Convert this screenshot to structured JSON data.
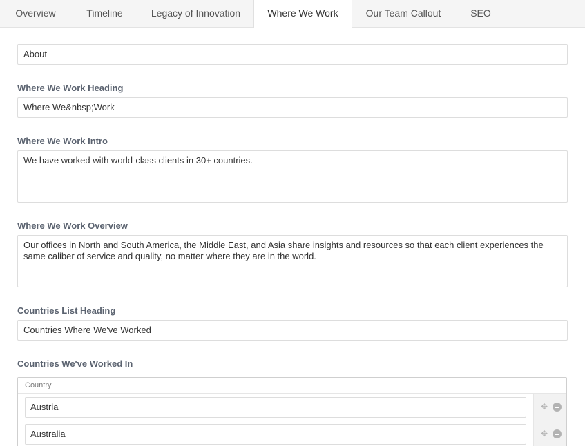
{
  "tabs": [
    {
      "label": "Overview"
    },
    {
      "label": "Timeline"
    },
    {
      "label": "Legacy of Innovation"
    },
    {
      "label": "Where We Work"
    },
    {
      "label": "Our Team Callout"
    },
    {
      "label": "SEO"
    }
  ],
  "form": {
    "section_value": "About",
    "heading": {
      "label": "Where We Work Heading",
      "value": "Where We&nbsp;Work"
    },
    "intro": {
      "label": "Where We Work Intro",
      "value": "We have worked with world-class clients in 30+ countries."
    },
    "overview": {
      "label": "Where We Work Overview",
      "value": "Our offices in North and South America, the Middle East, and Asia share insights and resources so that each client experiences the same caliber of service and quality, no matter where they are in the world."
    },
    "countries_heading": {
      "label": "Countries List Heading",
      "value": "Countries Where We've Worked"
    },
    "countries": {
      "label": "Countries We've Worked In",
      "column_header": "Country",
      "rows": [
        {
          "value": "Austria"
        },
        {
          "value": "Australia"
        }
      ]
    }
  },
  "icons": {
    "move": "move-icon",
    "remove": "remove-icon"
  }
}
